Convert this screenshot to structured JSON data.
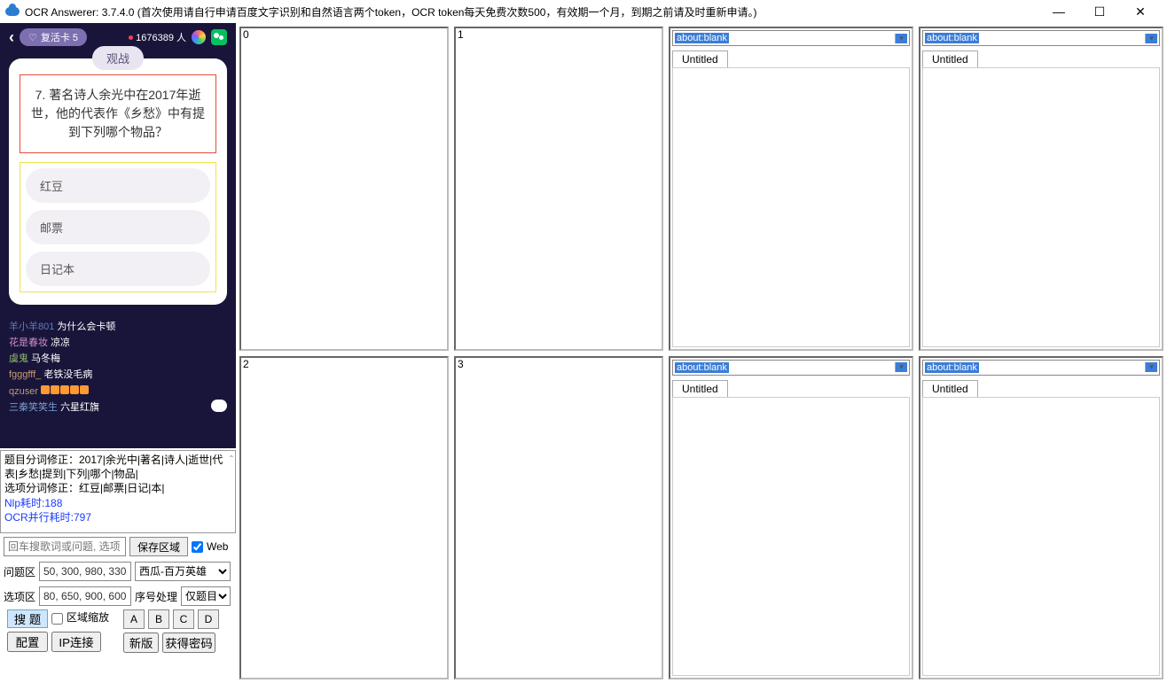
{
  "title": "OCR Answerer: 3.7.4.0 (首次使用请自行申请百度文字识别和自然语言两个token，OCR token每天免费次数500，有效期一个月，到期之前请及时重新申请。)",
  "phone": {
    "revive": "复活卡 5",
    "viewers": "1676389 人",
    "watch_tab": "观战",
    "question": "7. 著名诗人余光中在2017年逝世，他的代表作《乡愁》中有提到下列哪个物品？",
    "options": [
      "红豆",
      "邮票",
      "日记本"
    ]
  },
  "chat": [
    {
      "user": "羊小羊801",
      "cls": "u1",
      "msg": "为什么会卡顿"
    },
    {
      "user": "花是春妆",
      "cls": "u2",
      "msg": "凉凉"
    },
    {
      "user": "虞鬼",
      "cls": "u3",
      "msg": "马冬梅"
    },
    {
      "user": "fgggfff_",
      "cls": "u4",
      "msg": "老铁没毛病"
    },
    {
      "user": "qzuser",
      "cls": "u5",
      "msg": ""
    },
    {
      "user": "三秦笑笑生",
      "cls": "u6",
      "msg": "六星红旗"
    }
  ],
  "log": {
    "l1": "题目分词修正：2017|余光中|著名|诗人|逝世|代表|乡愁|提到|下列|哪个|物品|",
    "l2": "选项分词修正：红豆|邮票|日记|本|",
    "l3": "Nlp耗时:188",
    "l4": "OCR并行耗时:797"
  },
  "controls": {
    "search_ph": "回车搜歌词或问题, 选项",
    "save_area": "保存区域",
    "web_label": "Web",
    "q_label": "问题区",
    "q_coords": "50, 300, 980, 330",
    "provider": "西瓜-百万英雄",
    "o_label": "选项区",
    "o_coords": "80, 650, 900, 600",
    "seq_label": "序号处理",
    "seq_val": "仅题目",
    "search_btn": "搜 题",
    "zoom_label": "区域缩放",
    "abcd": [
      "A",
      "B",
      "C",
      "D"
    ],
    "config": "配置",
    "ip": "IP连接",
    "newver": "新版",
    "getpwd": "获得密码"
  },
  "panes": {
    "nums": [
      "0",
      "1",
      "2",
      "3"
    ],
    "url": "about:blank",
    "tab": "Untitled"
  }
}
